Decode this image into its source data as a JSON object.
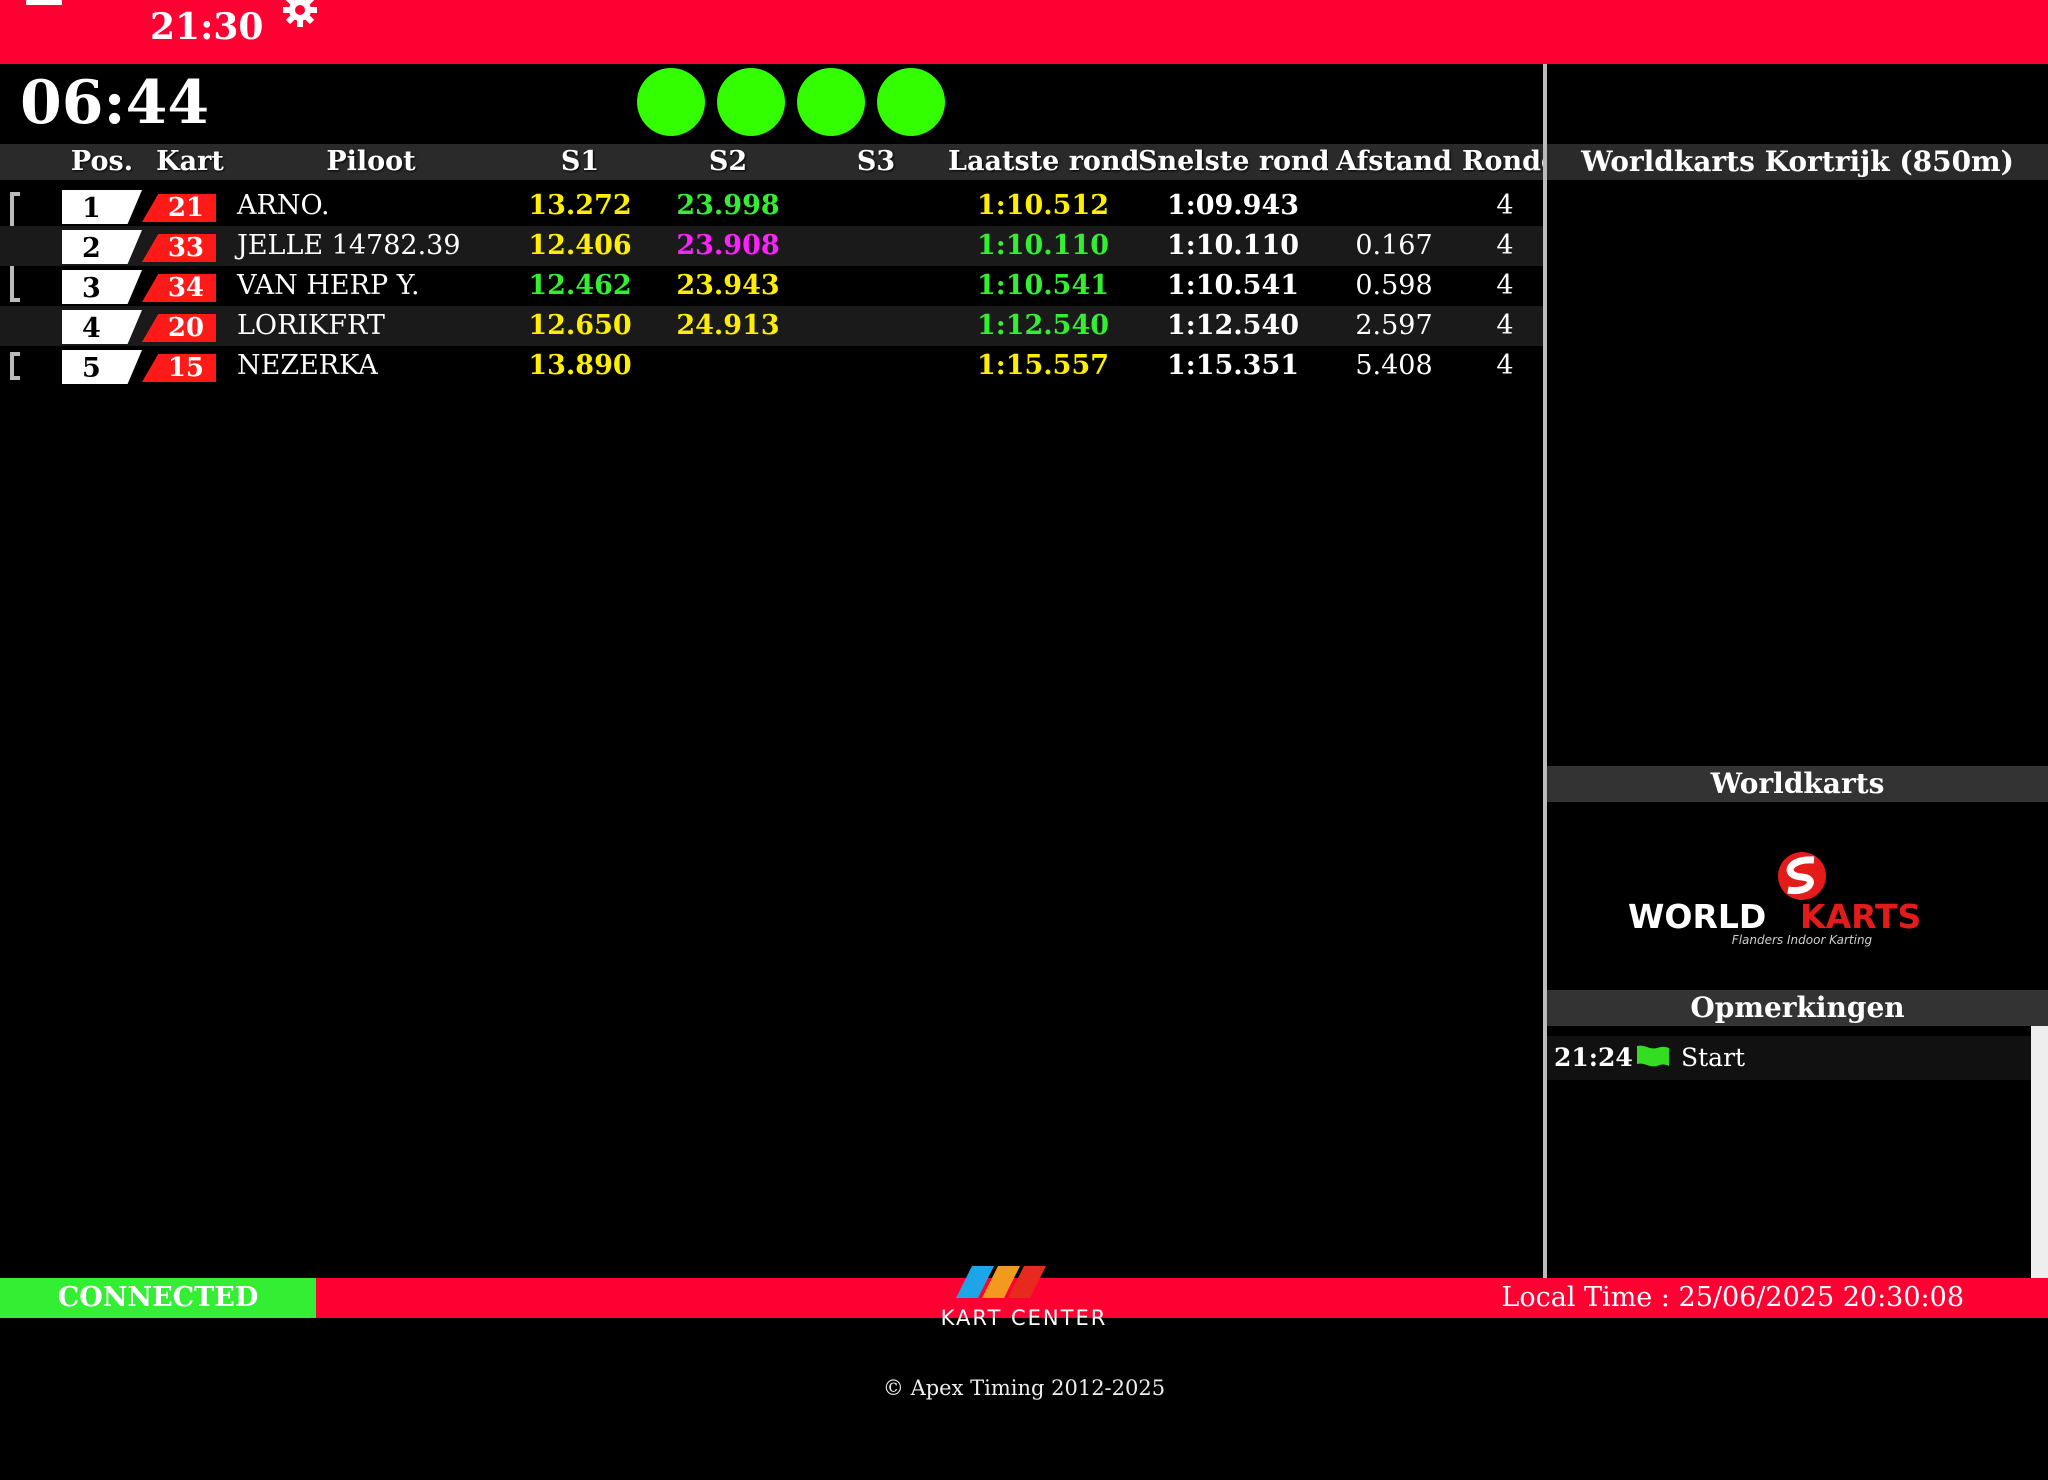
{
  "header": {
    "clock": "21:30",
    "timer": "06:44"
  },
  "columns": [
    "Pos.",
    "Kart",
    "Piloot",
    "S1",
    "S2",
    "S3",
    "Laatste ronde",
    "Snelste ronde",
    "Afstand",
    "Ronde"
  ],
  "rows": [
    {
      "pos": "1",
      "kart": "21",
      "driver": "ARNO.",
      "s1": "13.272",
      "s2": "23.998",
      "s3": "",
      "last": "1:10.512",
      "best": "1:09.943",
      "gap": "",
      "laps": "4"
    },
    {
      "pos": "2",
      "kart": "33",
      "driver": "JELLE 14782.39",
      "s1": "12.406",
      "s2": "23.908",
      "s3": "",
      "last": "1:10.110",
      "best": "1:10.110",
      "gap": "0.167",
      "laps": "4"
    },
    {
      "pos": "3",
      "kart": "34",
      "driver": "VAN HERP Y.",
      "s1": "12.462",
      "s2": "23.943",
      "s3": "",
      "last": "1:10.541",
      "best": "1:10.541",
      "gap": "0.598",
      "laps": "4"
    },
    {
      "pos": "4",
      "kart": "20",
      "driver": "LORIKFRT",
      "s1": "12.650",
      "s2": "24.913",
      "s3": "",
      "last": "1:12.540",
      "best": "1:12.540",
      "gap": "2.597",
      "laps": "4"
    },
    {
      "pos": "5",
      "kart": "15",
      "driver": "NEZERKA",
      "s1": "13.890",
      "s2": "",
      "s3": "",
      "last": "1:15.557",
      "best": "1:15.351",
      "gap": "5.408",
      "laps": "4"
    }
  ],
  "colors": {
    "accent": "#ff0033",
    "light": "#33ff00",
    "yellow": "#ffee00",
    "green": "#33ee33",
    "magenta": "#ff22ff",
    "kart": "#ff1a1a"
  },
  "sidebar": {
    "track_title": "Worldkarts Kortrijk (850m)",
    "brand_title": "Worldkarts",
    "logo_text_1": "WORLD",
    "logo_text_2": "KARTS",
    "logo_tagline": "Flanders Indoor Karting",
    "notes_title": "Opmerkingen",
    "notes": [
      {
        "time": "21:24",
        "icon": "green-flag-icon",
        "text": "Start"
      }
    ]
  },
  "footer": {
    "status": "CONNECTED",
    "local_time": "Local Time : 25/06/2025 20:30:08",
    "logo_text": "KART CENTER",
    "copyright": "© Apex Timing 2012-2025"
  }
}
